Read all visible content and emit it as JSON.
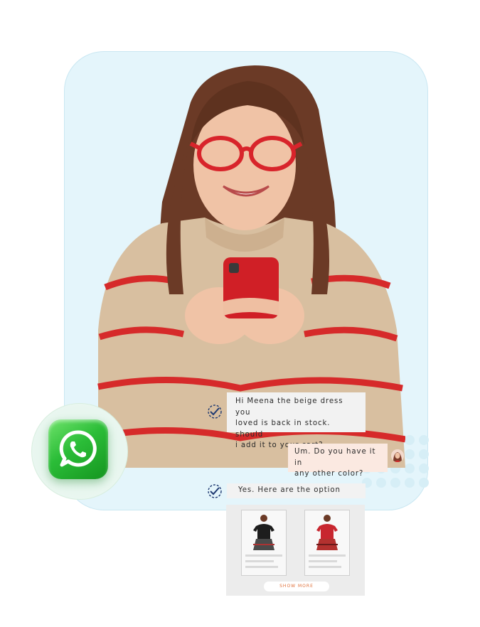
{
  "chat": {
    "incoming_message": "Hi Meena the beige dress you\nloved is back in stock. should\ni add it to your cart?",
    "reply_message": "Um. Do you have it  in\nany other color?",
    "answer_message": "Yes. Here are the option"
  },
  "products": {
    "items": [
      {
        "name": "black top",
        "color": "#1d1d1d"
      },
      {
        "name": "red top",
        "color": "#c8262f"
      }
    ],
    "show_more_label": "SHOW MORE"
  },
  "colors": {
    "background_card": "#e4f5fb",
    "incoming_bubble": "#f2f2f2",
    "reply_bubble": "#fbe9e1",
    "accent_orange": "#e0703a",
    "whatsapp_green": "#2bbd38",
    "checkmark_blue": "#1f3a72"
  },
  "icons": {
    "whatsapp": "whatsapp-icon",
    "read_receipt": "double-check-icon"
  }
}
